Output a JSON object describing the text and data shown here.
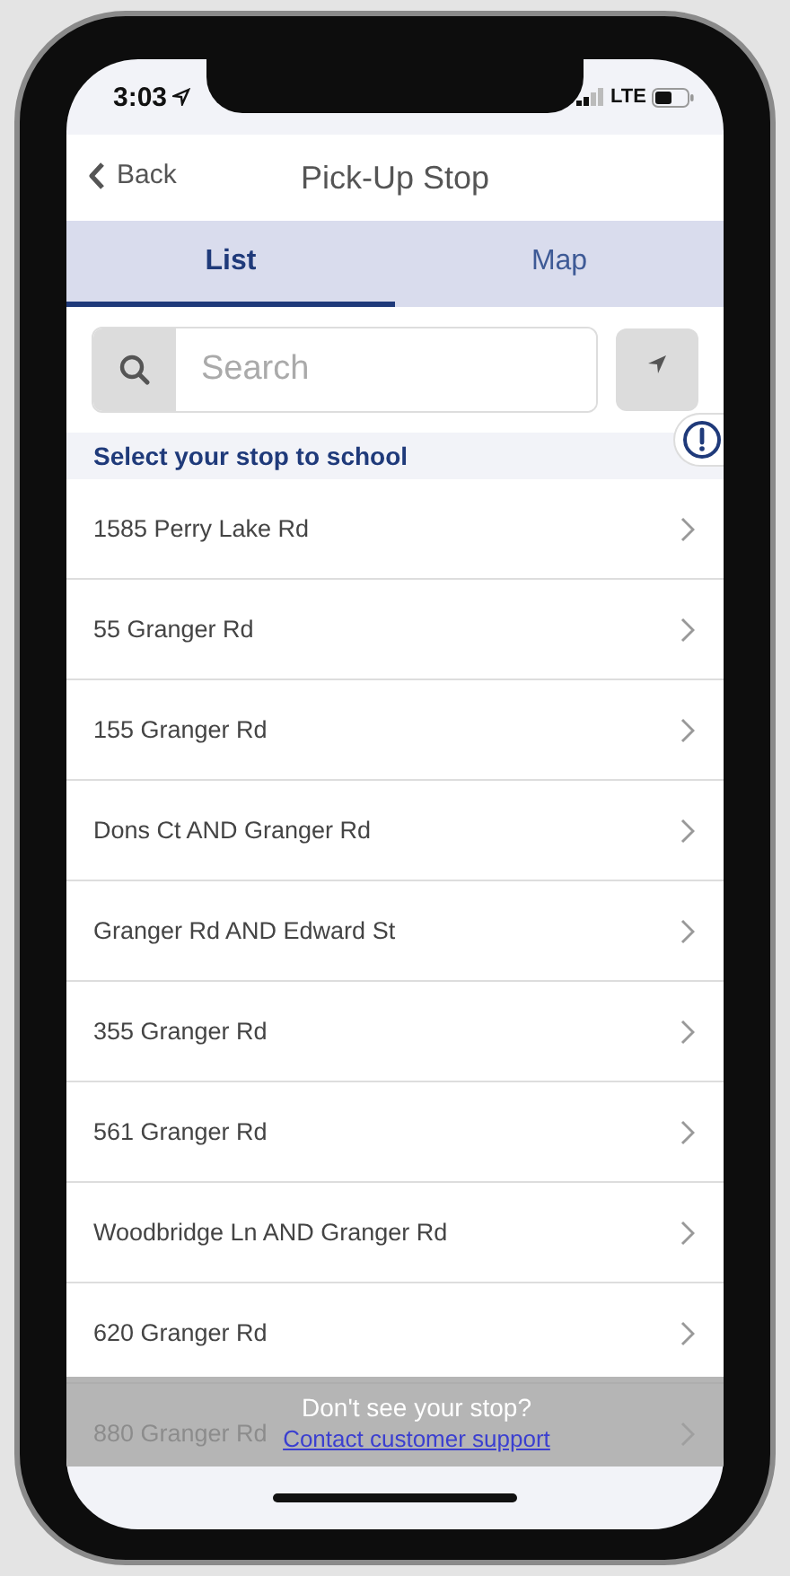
{
  "status_bar": {
    "time": "3:03",
    "network": "LTE"
  },
  "nav": {
    "back": "Back",
    "title": "Pick-Up Stop"
  },
  "tabs": [
    {
      "label": "List",
      "selected": true
    },
    {
      "label": "Map",
      "selected": false
    }
  ],
  "search": {
    "placeholder": "Search"
  },
  "section_header": "Select your stop to school",
  "stops": [
    "1585 Perry Lake Rd",
    "55 Granger Rd",
    "155 Granger Rd",
    "Dons Ct AND Granger Rd",
    "Granger Rd AND Edward St",
    "355 Granger Rd",
    "561 Granger Rd",
    "Woodbridge Ln AND Granger Rd",
    "620 Granger Rd",
    "880 Granger Rd"
  ],
  "footer": {
    "question": "Don't see your stop?",
    "link": "Contact customer support"
  }
}
